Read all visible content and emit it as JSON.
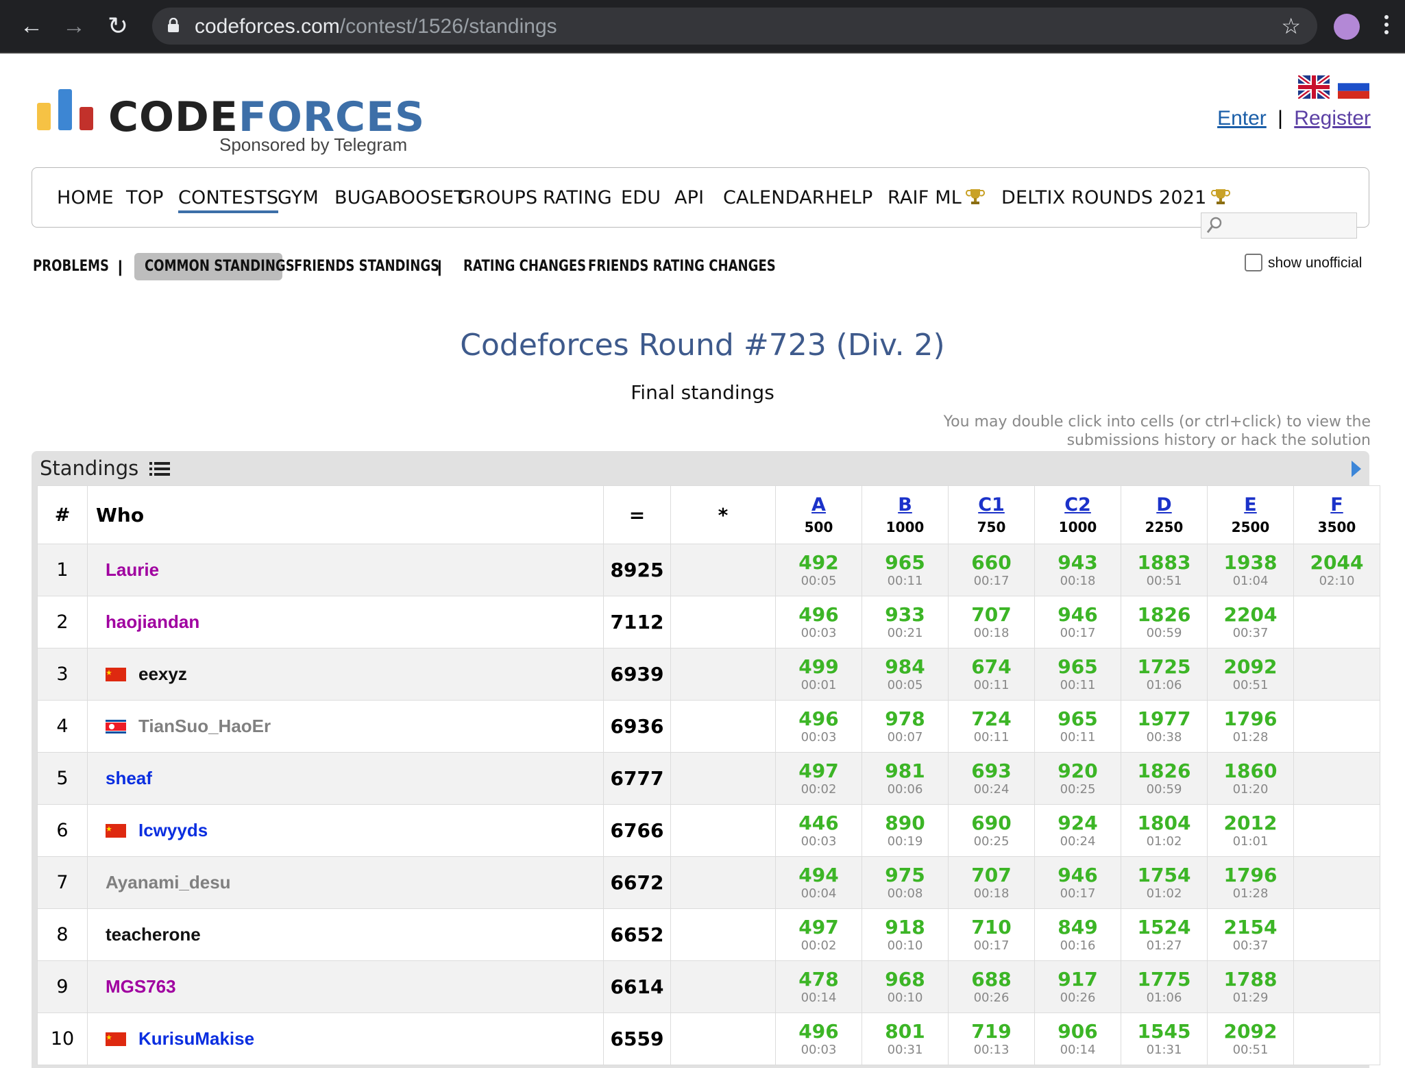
{
  "browser": {
    "url_host": "codeforces.com",
    "url_path": "/contest/1526/standings"
  },
  "header": {
    "logo_text_dark": "CODE",
    "logo_text_blue": "FORCES",
    "logo_sub": "Sponsored by Telegram",
    "enter": "Enter",
    "sep": "|",
    "register": "Register"
  },
  "menu": [
    "HOME",
    "TOP",
    "CONTESTS",
    "GYM",
    "BUGABOOSET",
    "GROUPS",
    "RATING",
    "EDU",
    "API",
    "CALENDAR",
    "HELP",
    "RAIF ML",
    "DELTIX ROUNDS 2021"
  ],
  "subnav": {
    "problems": "PROBLEMS",
    "common": "COMMON STANDINGS",
    "friends": "FRIENDS STANDINGS",
    "rating_changes": "RATING CHANGES",
    "friends_rating": "FRIENDS RATING CHANGES",
    "sep": "|",
    "show_unofficial": "show unofficial"
  },
  "page": {
    "title": "Codeforces Round #723 (Div. 2)",
    "subtitle": "Final standings",
    "hint_line1": "You may double click into cells (or ctrl+click) to view the",
    "hint_line2": "submissions history or hack the solution",
    "panel_title": "Standings"
  },
  "table": {
    "headers": {
      "rank": "#",
      "who": "Who",
      "points": "=",
      "penalty": "*"
    },
    "problems": [
      {
        "label": "A",
        "points": "500"
      },
      {
        "label": "B",
        "points": "1000"
      },
      {
        "label": "C1",
        "points": "750"
      },
      {
        "label": "C2",
        "points": "1000"
      },
      {
        "label": "D",
        "points": "2250"
      },
      {
        "label": "E",
        "points": "2500"
      },
      {
        "label": "F",
        "points": "3500"
      }
    ],
    "rows": [
      {
        "rank": "1",
        "who": "Laurie",
        "color": "#a000a0",
        "flag": "",
        "points": "8925",
        "cells": [
          [
            "492",
            "00:05"
          ],
          [
            "965",
            "00:11"
          ],
          [
            "660",
            "00:17"
          ],
          [
            "943",
            "00:18"
          ],
          [
            "1883",
            "00:51"
          ],
          [
            "1938",
            "01:04"
          ],
          [
            "2044",
            "02:10"
          ]
        ]
      },
      {
        "rank": "2",
        "who": "haojiandan",
        "color": "#a000a0",
        "flag": "",
        "points": "7112",
        "cells": [
          [
            "496",
            "00:03"
          ],
          [
            "933",
            "00:21"
          ],
          [
            "707",
            "00:18"
          ],
          [
            "946",
            "00:17"
          ],
          [
            "1826",
            "00:59"
          ],
          [
            "2204",
            "00:37"
          ],
          [
            "",
            ""
          ]
        ]
      },
      {
        "rank": "3",
        "who": "eexyz",
        "color": "#111111",
        "flag": "cn",
        "points": "6939",
        "cells": [
          [
            "499",
            "00:01"
          ],
          [
            "984",
            "00:05"
          ],
          [
            "674",
            "00:11"
          ],
          [
            "965",
            "00:11"
          ],
          [
            "1725",
            "01:06"
          ],
          [
            "2092",
            "00:51"
          ],
          [
            "",
            ""
          ]
        ]
      },
      {
        "rank": "4",
        "who": "TianSuo_HaoEr",
        "color": "#808080",
        "flag": "kp",
        "points": "6936",
        "cells": [
          [
            "496",
            "00:03"
          ],
          [
            "978",
            "00:07"
          ],
          [
            "724",
            "00:11"
          ],
          [
            "965",
            "00:11"
          ],
          [
            "1977",
            "00:38"
          ],
          [
            "1796",
            "01:28"
          ],
          [
            "",
            ""
          ]
        ]
      },
      {
        "rank": "5",
        "who": "sheaf",
        "color": "#0a2ee0",
        "flag": "",
        "points": "6777",
        "cells": [
          [
            "497",
            "00:02"
          ],
          [
            "981",
            "00:06"
          ],
          [
            "693",
            "00:24"
          ],
          [
            "920",
            "00:25"
          ],
          [
            "1826",
            "00:59"
          ],
          [
            "1860",
            "01:20"
          ],
          [
            "",
            ""
          ]
        ]
      },
      {
        "rank": "6",
        "who": "Icwyyds",
        "color": "#0a2ee0",
        "flag": "cn",
        "points": "6766",
        "cells": [
          [
            "446",
            "00:03"
          ],
          [
            "890",
            "00:19"
          ],
          [
            "690",
            "00:25"
          ],
          [
            "924",
            "00:24"
          ],
          [
            "1804",
            "01:02"
          ],
          [
            "2012",
            "01:01"
          ],
          [
            "",
            ""
          ]
        ]
      },
      {
        "rank": "7",
        "who": "Ayanami_desu",
        "color": "#808080",
        "flag": "",
        "points": "6672",
        "cells": [
          [
            "494",
            "00:04"
          ],
          [
            "975",
            "00:08"
          ],
          [
            "707",
            "00:18"
          ],
          [
            "946",
            "00:17"
          ],
          [
            "1754",
            "01:02"
          ],
          [
            "1796",
            "01:28"
          ],
          [
            "",
            ""
          ]
        ]
      },
      {
        "rank": "8",
        "who": "teacherone",
        "color": "#111111",
        "flag": "",
        "points": "6652",
        "cells": [
          [
            "497",
            "00:02"
          ],
          [
            "918",
            "00:10"
          ],
          [
            "710",
            "00:17"
          ],
          [
            "849",
            "00:16"
          ],
          [
            "1524",
            "01:27"
          ],
          [
            "2154",
            "00:37"
          ],
          [
            "",
            ""
          ]
        ]
      },
      {
        "rank": "9",
        "who": "MGS763",
        "color": "#a000a0",
        "flag": "",
        "points": "6614",
        "cells": [
          [
            "478",
            "00:14"
          ],
          [
            "968",
            "00:10"
          ],
          [
            "688",
            "00:26"
          ],
          [
            "917",
            "00:26"
          ],
          [
            "1775",
            "01:06"
          ],
          [
            "1788",
            "01:29"
          ],
          [
            "",
            ""
          ]
        ]
      },
      {
        "rank": "10",
        "who": "KurisuMakise",
        "color": "#0a2ee0",
        "flag": "cn",
        "points": "6559",
        "cells": [
          [
            "496",
            "00:03"
          ],
          [
            "801",
            "00:31"
          ],
          [
            "719",
            "00:13"
          ],
          [
            "906",
            "00:14"
          ],
          [
            "1545",
            "01:31"
          ],
          [
            "2092",
            "00:51"
          ],
          [
            "",
            ""
          ]
        ]
      }
    ]
  }
}
